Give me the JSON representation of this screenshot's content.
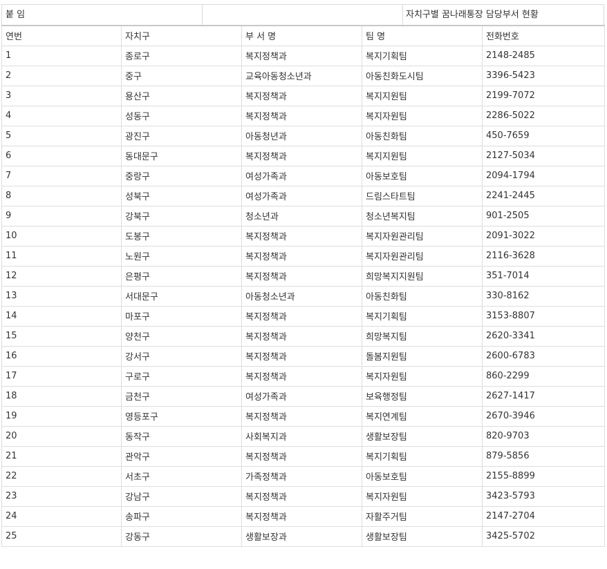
{
  "header": {
    "label": "붙 임",
    "middle": "",
    "title": "자치구별 꿈나래통장 담당부서 현황"
  },
  "table": {
    "columns": [
      "연번",
      "자치구",
      "부 서 명",
      "팀 명",
      "전화번호"
    ],
    "rows": [
      [
        "1",
        "종로구",
        "복지정책과",
        "복지기획팀",
        "2148-2485"
      ],
      [
        "2",
        "중구",
        "교육아동청소년과",
        "아동친화도시팀",
        "3396-5423"
      ],
      [
        "3",
        "용산구",
        "복지정책과",
        "복지지원팀",
        "2199-7072"
      ],
      [
        "4",
        "성동구",
        "복지정책과",
        "복지자원팀",
        "2286-5022"
      ],
      [
        "5",
        "광진구",
        "아동청년과",
        "아동친화팀",
        "450-7659"
      ],
      [
        "6",
        "동대문구",
        "복지정책과",
        "복지지원팀",
        "2127-5034"
      ],
      [
        "7",
        "중랑구",
        "여성가족과",
        "아동보호팀",
        "2094-1794"
      ],
      [
        "8",
        "성북구",
        "여성가족과",
        "드림스타트팀",
        "2241-2445"
      ],
      [
        "9",
        "강북구",
        "청소년과",
        "청소년복지팀",
        "901-2505"
      ],
      [
        "10",
        "도봉구",
        "복지정책과",
        "복지자원관리팀",
        "2091-3022"
      ],
      [
        "11",
        "노원구",
        "복지정책과",
        "복지자원관리팀",
        "2116-3628"
      ],
      [
        "12",
        "은평구",
        "복지정책과",
        "희망복지지원팀",
        "351-7014"
      ],
      [
        "13",
        "서대문구",
        "아동청소년과",
        "아동친화팀",
        "330-8162"
      ],
      [
        "14",
        "마포구",
        "복지정책과",
        "복지기획팀",
        "3153-8807"
      ],
      [
        "15",
        "양천구",
        "복지정책과",
        "희망복지팀",
        "2620-3341"
      ],
      [
        "16",
        "강서구",
        "복지정책과",
        "돌봄지원팀",
        "2600-6783"
      ],
      [
        "17",
        "구로구",
        "복지정책과",
        "복지자원팀",
        "860-2299"
      ],
      [
        "18",
        "금천구",
        "여성가족과",
        "보육행정팀",
        "2627-1417"
      ],
      [
        "19",
        "영등포구",
        "복지정책과",
        "복지연계팀",
        "2670-3946"
      ],
      [
        "20",
        "동작구",
        "사회복지과",
        "생활보장팀",
        "820-9703"
      ],
      [
        "21",
        "관악구",
        "복지정책과",
        "복지기획팀",
        "879-5856"
      ],
      [
        "22",
        "서초구",
        "가족정책과",
        "아동보호팀",
        "2155-8899"
      ],
      [
        "23",
        "강남구",
        "복지정책과",
        "복지자원팀",
        "3423-5793"
      ],
      [
        "24",
        "송파구",
        "복지정책과",
        "자활주거팀",
        "2147-2704"
      ],
      [
        "25",
        "강동구",
        "생활보장과",
        "생활보장팀",
        "3425-5702"
      ]
    ]
  }
}
